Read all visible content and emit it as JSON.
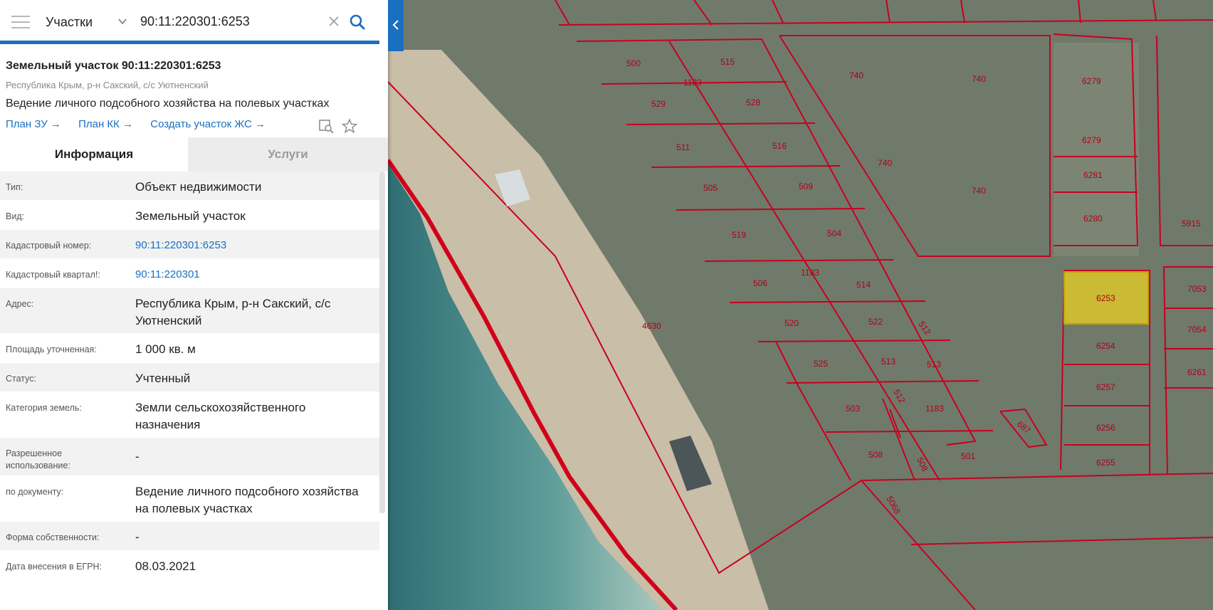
{
  "search": {
    "layer": "Участки",
    "value": "90:11:220301:6253"
  },
  "card": {
    "title": "Земельный участок 90:11:220301:6253",
    "address_short": "Республика Крым, р-н Сакский, с/с Уютненский",
    "purpose": "Ведение личного подсобного хозяйства на полевых участках",
    "links": [
      "План ЗУ →",
      "План КК →",
      "Создать участок ЖС →"
    ]
  },
  "tabs": [
    "Информация",
    "Услуги"
  ],
  "rows": [
    {
      "label": "Тип:",
      "value": "Объект недвижимости"
    },
    {
      "label": "Вид:",
      "value": "Земельный участок"
    },
    {
      "label": "Кадастровый номер:",
      "value": "90:11:220301:6253"
    },
    {
      "label": "Кадастровый квартал!:",
      "value": "90:11:220301"
    },
    {
      "label": "Адрес:",
      "value": "Республика Крым, р-н Сакский, с/с Уютненский"
    },
    {
      "label": "Площадь уточненная:",
      "value": "1 000 кв. м"
    },
    {
      "label": "Статус:",
      "value": "Учтенный"
    },
    {
      "label": "Категория земель:",
      "value": "Земли сельскохозяйственного назначения"
    },
    {
      "label": "Разрешенное использование:",
      "value": "-"
    },
    {
      "label": "по документу:",
      "value": "Ведение личного подсобного хозяйства на полевых участках"
    },
    {
      "label": "Форма собственности:",
      "value": "-"
    },
    {
      "label": "Дата внесения в ЕГРН:",
      "value": "08.03.2021"
    }
  ],
  "map_labels": [
    "500",
    "515",
    "1183",
    "529",
    "528",
    "511",
    "516",
    "505",
    "509",
    "519",
    "504",
    "506",
    "1183",
    "514",
    "520",
    "522",
    "512",
    "525",
    "513",
    "513",
    "503",
    "512",
    "1183",
    "508",
    "508",
    "501",
    "5068",
    "4630",
    "740",
    "740",
    "740",
    "740",
    "6279",
    "6279",
    "6281",
    "6280",
    "5915",
    "6253",
    "7053",
    "7054",
    "6254",
    "6261",
    "6257",
    "6256",
    "6255",
    "687"
  ],
  "colors": {
    "accent": "#1b6fc0",
    "parcel_line": "#c8001e",
    "selected_parcel": "#d9c62a"
  }
}
